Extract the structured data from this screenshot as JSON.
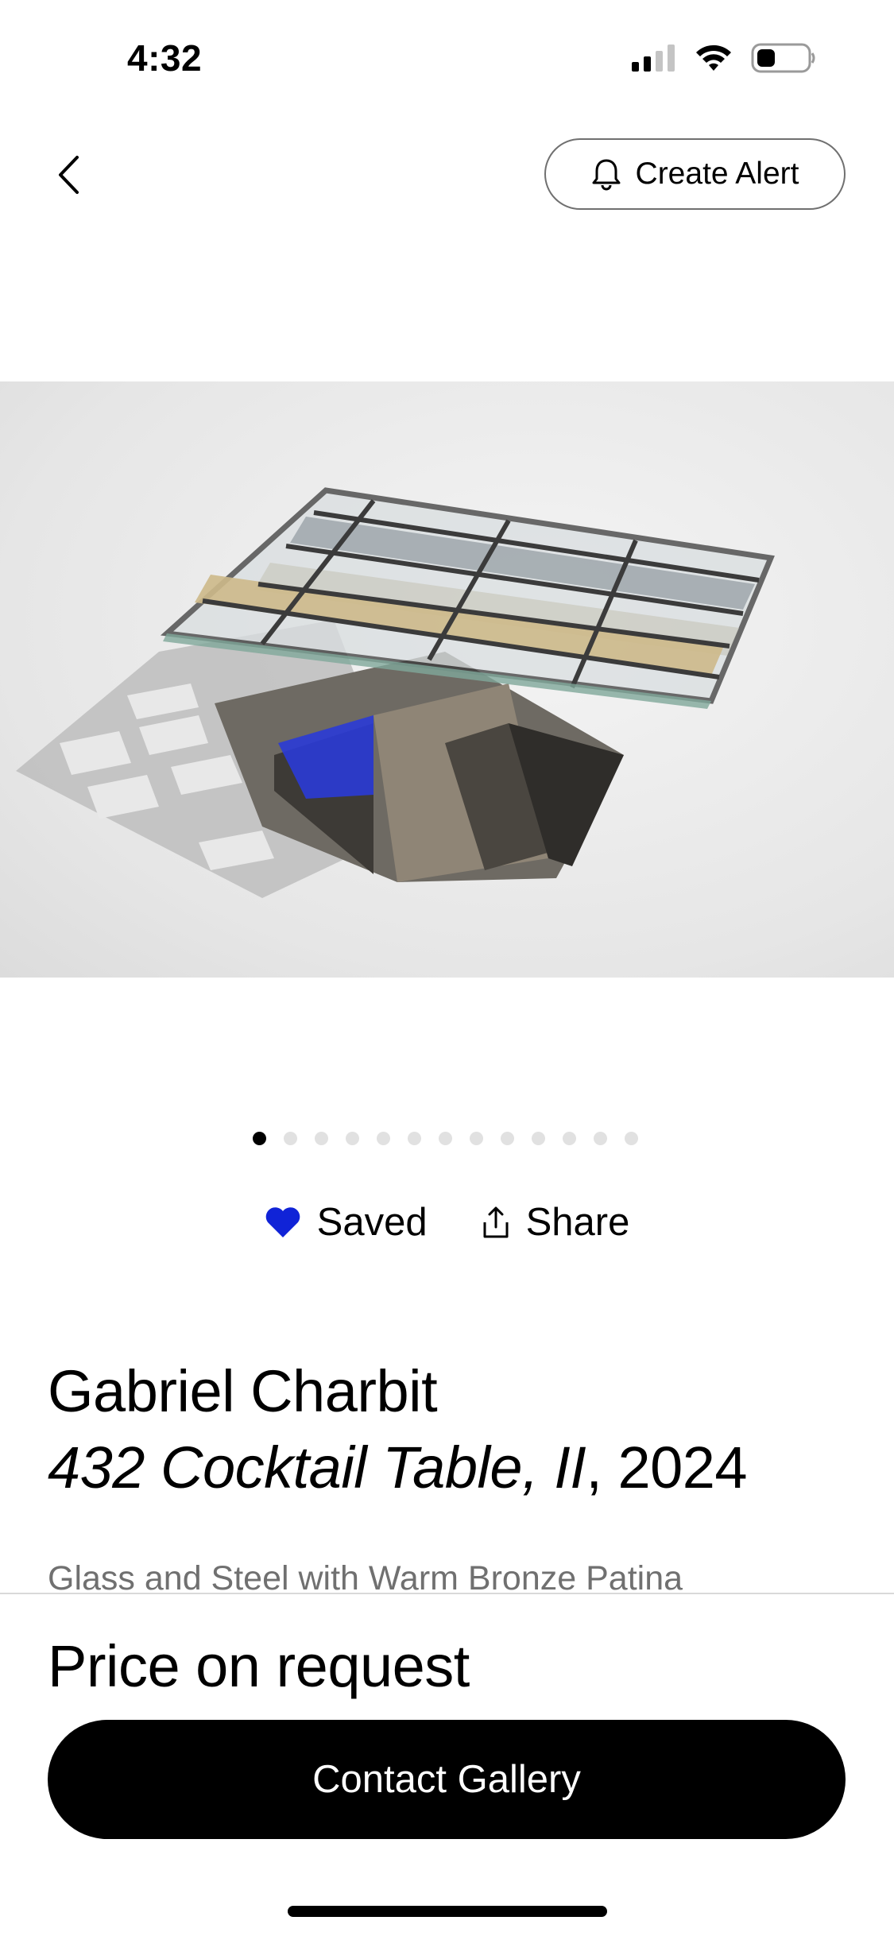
{
  "status_bar": {
    "time": "4:32"
  },
  "nav": {
    "back_icon": "chevron-left-icon",
    "alert_icon": "bell-icon",
    "create_alert_label": "Create Alert"
  },
  "gallery": {
    "image_count": 13,
    "active_index": 0
  },
  "actions": {
    "saved_label": "Saved",
    "saved_icon": "heart-icon",
    "saved_color": "#1023d7",
    "share_label": "Share",
    "share_icon": "share-icon"
  },
  "artwork": {
    "artist": "Gabriel Charbit",
    "title": "432 Cocktail Table, II",
    "year": "2024",
    "medium": "Glass and Steel with Warm Bronze Patina"
  },
  "purchase": {
    "price": "Price on request",
    "contact_label": "Contact Gallery"
  }
}
